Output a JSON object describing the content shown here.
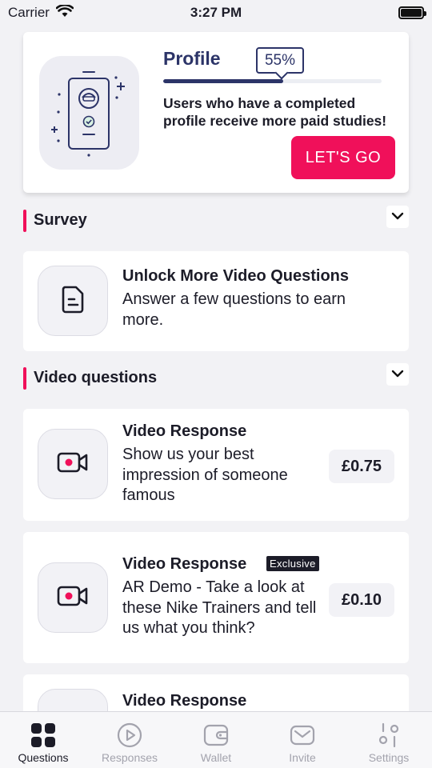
{
  "status_bar": {
    "carrier": "Carrier",
    "time": "3:27 PM"
  },
  "profile": {
    "title": "Profile",
    "percent_label": "55%",
    "progress": 0.55,
    "description": "Users who have a completed profile receive more paid studies!",
    "cta_label": "LET'S GO"
  },
  "sections": [
    {
      "title": "Survey"
    },
    {
      "title": "Video questions"
    }
  ],
  "survey_card": {
    "title": "Unlock More Video Questions",
    "text": "Answer a few questions to earn more."
  },
  "video_cards": [
    {
      "title": "Video Response",
      "badge": "",
      "text": "Show us your best impression of someone famous",
      "price": "£0.75"
    },
    {
      "title": "Video Response",
      "badge": "Exclusive",
      "text": "AR Demo - Take a look at these Nike Trainers and tell us what you think?",
      "price": "£0.10"
    },
    {
      "title": "Video Response"
    }
  ],
  "tabs": [
    {
      "label": "Questions",
      "icon": "grid-icon",
      "active": true
    },
    {
      "label": "Responses",
      "icon": "play-circle-icon",
      "active": false
    },
    {
      "label": "Wallet",
      "icon": "wallet-icon",
      "active": false
    },
    {
      "label": "Invite",
      "icon": "mail-icon",
      "active": false
    },
    {
      "label": "Settings",
      "icon": "sliders-icon",
      "active": false
    }
  ],
  "colors": {
    "accent": "#f0105a",
    "navy": "#2c3468",
    "background": "#f2f2f5"
  }
}
